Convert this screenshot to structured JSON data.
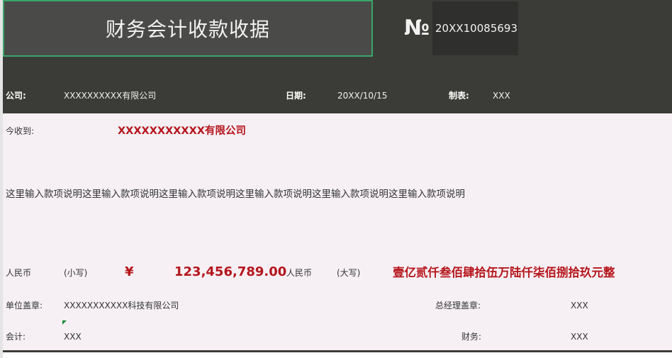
{
  "header": {
    "title": "财务会计收款收据",
    "no_sign": "№",
    "no_value": "20XX10085693"
  },
  "info": {
    "company_label": "公司:",
    "company_value": "XXXXXXXXXX有限公司",
    "date_label": "日期:",
    "date_value": "20XX/10/15",
    "maker_label": "制表:",
    "maker_value": "XXX"
  },
  "receipt": {
    "received_label": "今收到:",
    "received_from": "XXXXXXXXXXX有限公司",
    "description": "这里输入款项说明这里输入款项说明这里输入款项说明这里输入款项说明这里输入款项说明这里输入款项说明",
    "rmb_label_small": "人民币",
    "small_label": "(小写)",
    "yen_sign": "¥",
    "amount_small": "123,456,789.00",
    "rmb_label_big": "人民币",
    "big_label": "(大写)",
    "amount_big": "壹亿贰仟叁佰肆拾伍万陆仟柒佰捌拾玖元整"
  },
  "signatures": {
    "unit_seal_label": "单位盖章:",
    "unit_seal_value": "XXXXXXXXXXX科技有限公司",
    "gm_seal_label": "总经理盖章:",
    "gm_seal_value": "XXX",
    "accountant_label": "会计:",
    "accountant_value": "XXX",
    "finance_label": "财务:",
    "finance_value": "XXX"
  },
  "colors": {
    "header_dark": "#3b3c38",
    "title_border": "#3aa56a",
    "accent_red": "#b5161c",
    "body_bg": "#f6f0f4"
  }
}
